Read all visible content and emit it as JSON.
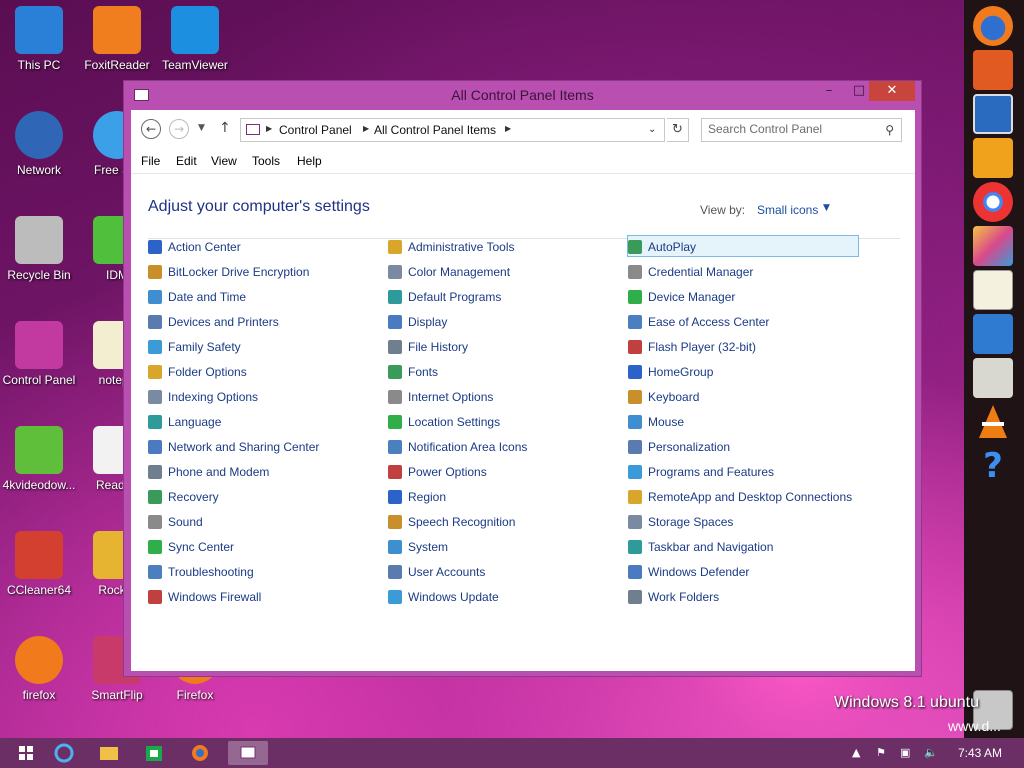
{
  "desktop": {
    "icons": [
      {
        "label": "This PC",
        "icon": "this-pc-icon"
      },
      {
        "label": "FoxitReader",
        "icon": "foxit-reader-icon"
      },
      {
        "label": "TeamViewer",
        "icon": "teamviewer-icon"
      },
      {
        "label": "Network",
        "icon": "network-icon"
      },
      {
        "label": "Free Sof",
        "icon": "internet-explorer-icon"
      },
      {
        "label": "Recycle Bin",
        "icon": "recycle-bin-icon"
      },
      {
        "label": "IDM",
        "icon": "idm-icon"
      },
      {
        "label": "Control Panel",
        "icon": "control-panel-icon"
      },
      {
        "label": "notepa",
        "icon": "notepad-icon"
      },
      {
        "label": "4kvideodow...",
        "icon": "video-downloader-icon"
      },
      {
        "label": "Read M",
        "icon": "document-icon"
      },
      {
        "label": "CCleaner64",
        "icon": "ccleaner-icon"
      },
      {
        "label": "Rocket",
        "icon": "rocket-icon"
      },
      {
        "label": "firefox",
        "icon": "firefox-icon"
      },
      {
        "label": "SmartFlip",
        "icon": "smartflip-icon"
      },
      {
        "label": "Firefox",
        "icon": "firefox-icon"
      }
    ]
  },
  "window": {
    "title": "All Control Panel Items",
    "address": {
      "crumbs": [
        "Control Panel",
        "All Control Panel Items"
      ]
    },
    "search": {
      "placeholder": "Search Control Panel"
    },
    "menu": [
      "File",
      "Edit",
      "View",
      "Tools",
      "Help"
    ],
    "heading": "Adjust your computer's settings",
    "view_by": {
      "label": "View by:",
      "value": "Small icons"
    },
    "items": {
      "col1": [
        "Action Center",
        "BitLocker Drive Encryption",
        "Date and Time",
        "Devices and Printers",
        "Family Safety",
        "Folder Options",
        "Indexing Options",
        "Language",
        "Network and Sharing Center",
        "Phone and Modem",
        "Recovery",
        "Sound",
        "Sync Center",
        "Troubleshooting",
        "Windows Firewall"
      ],
      "col2": [
        "Administrative Tools",
        "Color Management",
        "Default Programs",
        "Display",
        "File History",
        "Fonts",
        "Internet Options",
        "Location Settings",
        "Notification Area Icons",
        "Power Options",
        "Region",
        "Speech Recognition",
        "System",
        "User Accounts",
        "Windows Update"
      ],
      "col3": [
        "AutoPlay",
        "Credential Manager",
        "Device Manager",
        "Ease of Access Center",
        "Flash Player (32-bit)",
        "HomeGroup",
        "Keyboard",
        "Mouse",
        "Personalization",
        "Programs and Features",
        "RemoteApp and Desktop Connections",
        "Storage Spaces",
        "Taskbar and Navigation",
        "Windows Defender",
        "Work Folders"
      ]
    },
    "selected_item": "AutoPlay"
  },
  "watermark": {
    "line1": "Windows 8.1 ubuntu",
    "line2": "www.d..."
  },
  "taskbar": {
    "clock": "7:43 AM"
  },
  "colors": {
    "accent": "#b84fb1",
    "link": "#1b3b86",
    "heading": "#1e3287",
    "close": "#c7453d"
  }
}
